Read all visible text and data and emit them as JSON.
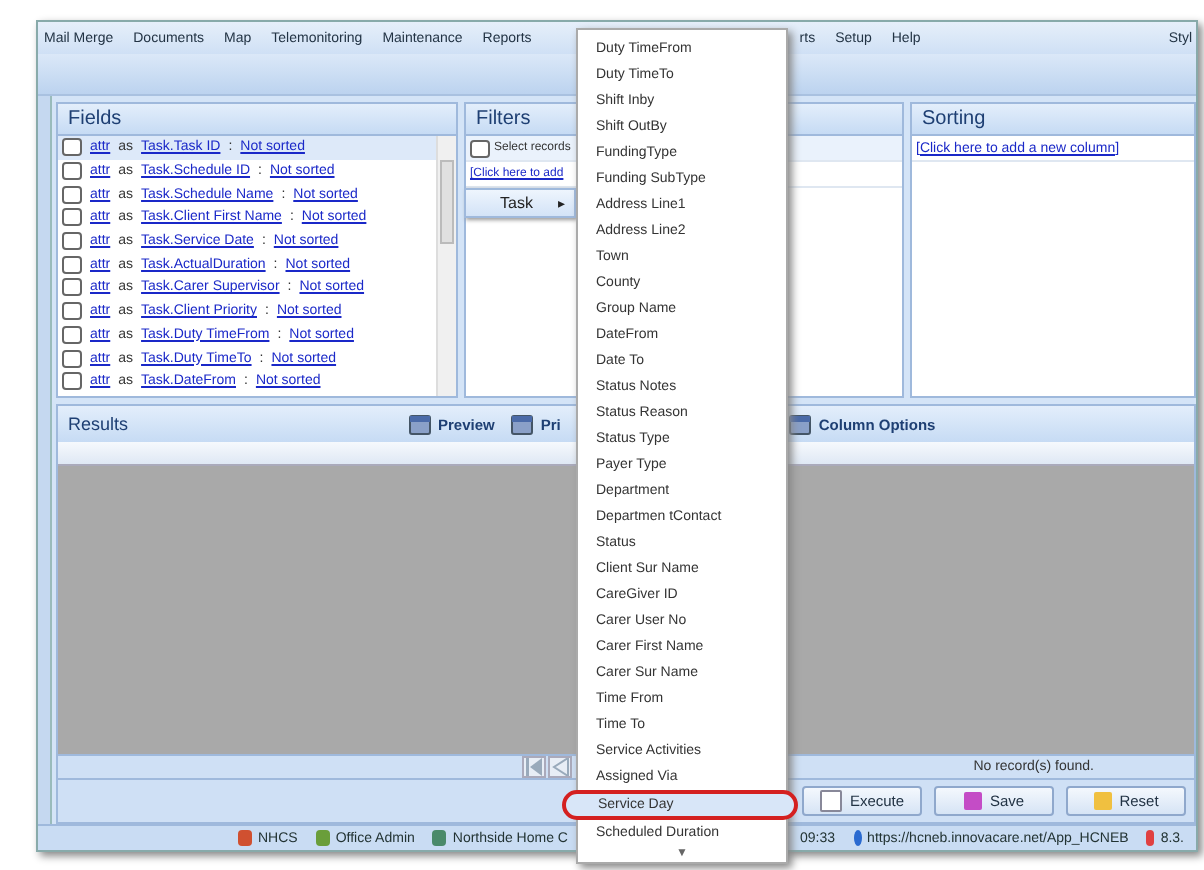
{
  "menu_bar": [
    "Mail Merge",
    "Documents",
    "Map",
    "Telemonitoring",
    "Maintenance",
    "Reports",
    "rts",
    "Setup",
    "Help",
    "Styl"
  ],
  "fields": {
    "title": "Fields",
    "rows": [
      {
        "attr": "attr",
        "as": "as",
        "name": "Task.Task ID",
        "sep": ":",
        "sort": "Not sorted",
        "selected": true
      },
      {
        "attr": "attr",
        "as": "as",
        "name": "Task.Schedule ID",
        "sep": ":",
        "sort": "Not sorted",
        "selected": false
      },
      {
        "attr": "attr",
        "as": "as",
        "name": "Task.Schedule Name",
        "sep": ":",
        "sort": "Not sorted",
        "selected": false
      },
      {
        "attr": "attr",
        "as": "as",
        "name": "Task.Client First Name",
        "sep": ":",
        "sort": "Not sorted",
        "selected": false
      },
      {
        "attr": "attr",
        "as": "as",
        "name": "Task.Service Date",
        "sep": ":",
        "sort": "Not sorted",
        "selected": false
      },
      {
        "attr": "attr",
        "as": "as",
        "name": "Task.ActualDuration",
        "sep": ":",
        "sort": "Not sorted",
        "selected": false
      },
      {
        "attr": "attr",
        "as": "as",
        "name": "Task.Carer Supervisor",
        "sep": ":",
        "sort": "Not sorted",
        "selected": false
      },
      {
        "attr": "attr",
        "as": "as",
        "name": "Task.Client Priority",
        "sep": ":",
        "sort": "Not sorted",
        "selected": false
      },
      {
        "attr": "attr",
        "as": "as",
        "name": "Task.Duty TimeFrom",
        "sep": ":",
        "sort": "Not sorted",
        "selected": false
      },
      {
        "attr": "attr",
        "as": "as",
        "name": "Task.Duty TimeTo",
        "sep": ":",
        "sort": "Not sorted",
        "selected": false
      },
      {
        "attr": "attr",
        "as": "as",
        "name": "Task.DateFrom",
        "sep": ":",
        "sort": "Not sorted",
        "selected": false
      }
    ]
  },
  "filters": {
    "title": "Filters",
    "checked": false,
    "select_label": "Select records",
    "add_link": "[Click here to add"
  },
  "sorting": {
    "title": "Sorting",
    "add_link": "[Click here to add a new column]"
  },
  "submenu": {
    "label": "Task",
    "arrow": "▸"
  },
  "dropdown": {
    "items": [
      {
        "label": "Duty TimeFrom",
        "selected": false
      },
      {
        "label": "Duty TimeTo",
        "selected": false
      },
      {
        "label": "Shift Inby",
        "selected": false
      },
      {
        "label": "Shift OutBy",
        "selected": false
      },
      {
        "label": "FundingType",
        "selected": false
      },
      {
        "label": "Funding SubType",
        "selected": false
      },
      {
        "label": "Address Line1",
        "selected": false
      },
      {
        "label": "Address Line2",
        "selected": false
      },
      {
        "label": "Town",
        "selected": false
      },
      {
        "label": "County",
        "selected": false
      },
      {
        "label": "Group Name",
        "selected": false
      },
      {
        "label": "DateFrom",
        "selected": false
      },
      {
        "label": "Date To",
        "selected": false
      },
      {
        "label": "Status Notes",
        "selected": false
      },
      {
        "label": "Status Reason",
        "selected": false
      },
      {
        "label": "Status Type",
        "selected": false
      },
      {
        "label": "Payer Type",
        "selected": false
      },
      {
        "label": "Department",
        "selected": false
      },
      {
        "label": "Departmen tContact",
        "selected": false
      },
      {
        "label": "Status",
        "selected": false
      },
      {
        "label": "Client Sur Name",
        "selected": false
      },
      {
        "label": "CareGiver ID",
        "selected": false
      },
      {
        "label": "Carer User No",
        "selected": false
      },
      {
        "label": "Carer First Name",
        "selected": false
      },
      {
        "label": "Carer Sur Name",
        "selected": false
      },
      {
        "label": "Time From",
        "selected": false
      },
      {
        "label": "Time To",
        "selected": false
      },
      {
        "label": "Service Activities",
        "selected": false
      },
      {
        "label": "Assigned Via",
        "selected": false
      },
      {
        "label": "Service Day",
        "selected": true
      },
      {
        "label": "Scheduled Duration",
        "selected": false
      }
    ],
    "more": "▼"
  },
  "results": {
    "title": "Results",
    "tools": [
      "Preview",
      "Pri",
      "Column Options"
    ],
    "pager_status": "No record(s) found."
  },
  "actions": [
    "Execute",
    "Save",
    "Reset"
  ],
  "status_bar": {
    "items": [
      "NHCS",
      "Office Admin",
      "Northside Home C"
    ],
    "time": "09:33",
    "url": "https://hcneb.innovacare.net/App_HCNEB",
    "version": "8.3."
  }
}
